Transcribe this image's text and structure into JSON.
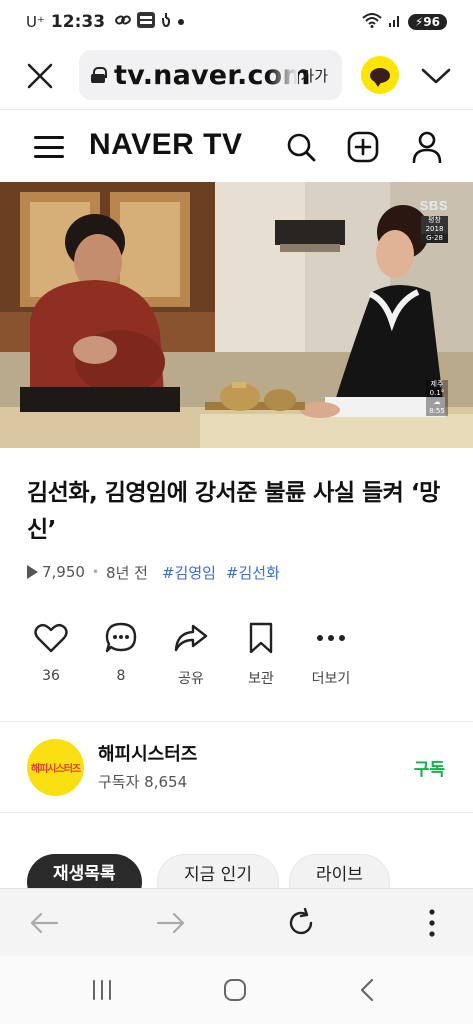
{
  "status_bar": {
    "carrier": "U⁺",
    "time": "12:33",
    "icons": [
      "link-icon",
      "cid-icon",
      "notification-icon",
      "dot"
    ],
    "battery": "96"
  },
  "browser": {
    "url": "tv.naver.com",
    "text_size_label": "가가"
  },
  "header": {
    "logo": "NAVER TV"
  },
  "video": {
    "broadcaster": "SBS",
    "rating_line1": "평창 2018",
    "rating_line2": "G-28",
    "weather_line1": "제주",
    "weather_line2": "0.1°",
    "weather_time": "8:55"
  },
  "clip": {
    "title": "김선화, 김영임에 강서준 불륜 사실 들켜 ‘망신’",
    "views": "7,950",
    "age": "8년 전",
    "tags": [
      "#김영임",
      "#김선화"
    ]
  },
  "actions": {
    "like_count": "36",
    "comment_count": "8",
    "share_label": "공유",
    "save_label": "보관",
    "more_label": "더보기"
  },
  "channel": {
    "name": "해피시스터즈",
    "avatar_text": "해피시스터즈",
    "subscribers": "구독자 8,654",
    "subscribe_label": "구독"
  },
  "chips": [
    "재생목록",
    "지금 인기",
    "라이브"
  ],
  "colors": {
    "accent_green": "#13b34a",
    "tag_blue": "#3b6ed6",
    "kakao_yellow": "#fee500"
  }
}
